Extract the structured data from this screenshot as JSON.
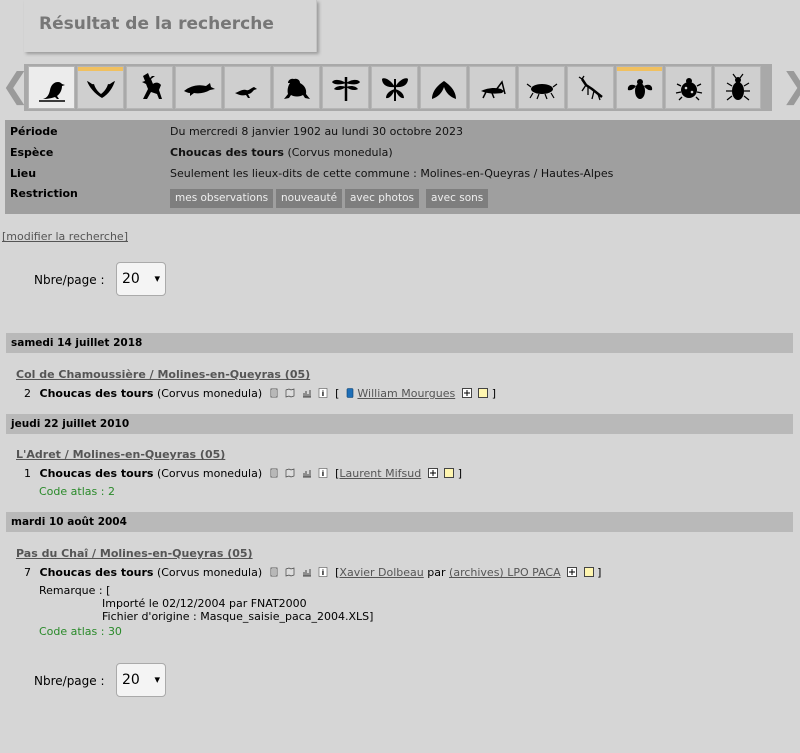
{
  "page": {
    "title": "Résultat de la recherche"
  },
  "taxa_nav": {
    "left_arrow": "❮",
    "right_arrow": "❯",
    "items": [
      {
        "icon": "bird-icon",
        "active": true,
        "marked": false
      },
      {
        "icon": "bat-icon",
        "active": false,
        "marked": true
      },
      {
        "icon": "deer-icon",
        "active": false,
        "marked": false
      },
      {
        "icon": "dolphin-icon",
        "active": false,
        "marked": false
      },
      {
        "icon": "lizard-icon",
        "active": false,
        "marked": false
      },
      {
        "icon": "frog-icon",
        "active": false,
        "marked": false
      },
      {
        "icon": "dragonfly-icon",
        "active": false,
        "marked": false
      },
      {
        "icon": "butterfly-icon",
        "active": false,
        "marked": false
      },
      {
        "icon": "moth-icon",
        "active": false,
        "marked": false
      },
      {
        "icon": "grasshopper-icon",
        "active": false,
        "marked": false
      },
      {
        "icon": "cicada-icon",
        "active": false,
        "marked": false
      },
      {
        "icon": "mantis-icon",
        "active": false,
        "marked": false
      },
      {
        "icon": "fly-icon",
        "active": false,
        "marked": true
      },
      {
        "icon": "ladybug-icon",
        "active": false,
        "marked": false
      },
      {
        "icon": "beetle-icon",
        "active": false,
        "marked": false
      }
    ]
  },
  "criteria": {
    "periode_label": "Période",
    "periode_value": "Du mercredi 8 janvier 1902 au lundi 30 octobre 2023",
    "espece_label": "Espèce",
    "espece_name": "Choucas des tours",
    "espece_latin": "(Corvus monedula)",
    "lieu_label": "Lieu",
    "lieu_value": "Seulement les lieux-dits de cette commune : Molines-en-Queyras / Hautes-Alpes",
    "restriction_label": "Restriction",
    "restrictions": [
      "mes observations",
      "nouveauté",
      "avec photos",
      "avec sons"
    ]
  },
  "modify_link": "[modifier la recherche]",
  "pager": {
    "label": "Nbre/page :",
    "value": "20",
    "chevron": "▾"
  },
  "results": [
    {
      "date": "samedi 14 juillet 2018",
      "place": "Col de Chamoussière / Molines-en-Queyras (05)",
      "count": "2",
      "species": "Choucas des tours",
      "latin": "(Corvus monedula)",
      "observer": "William Mourgues",
      "code": ""
    },
    {
      "date": "jeudi 22 juillet 2010",
      "place": "L'Adret / Molines-en-Queyras (05)",
      "count": "1",
      "species": "Choucas des tours",
      "latin": "(Corvus monedula)",
      "observer": "Laurent Mifsud",
      "code": "Code atlas : 2"
    },
    {
      "date": "mardi 10 août 2004",
      "place": "Pas du Chaî / Molines-en-Queyras (05)",
      "count": "7",
      "species": "Choucas des tours",
      "latin": "(Corvus monedula)",
      "observer": "Xavier Dolbeau",
      "par": "par",
      "org": "(archives) LPO PACA",
      "remark_label": "Remarque : [",
      "remark_line1": "Importé le 02/12/2004 par FNAT2000",
      "remark_line2": "Fichier d'origine : Masque_saisie_paca_2004.XLS]",
      "code": "Code atlas : 30"
    }
  ],
  "brackets": {
    "open": "[",
    "close": "]"
  }
}
